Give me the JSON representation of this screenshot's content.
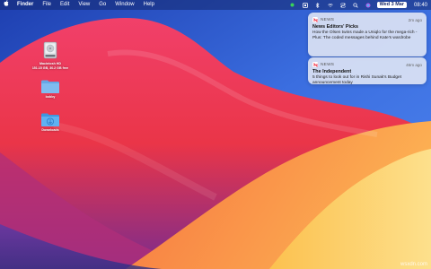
{
  "menubar": {
    "apple_icon": "apple-icon",
    "items": [
      "Finder",
      "File",
      "Edit",
      "View",
      "Go",
      "Window",
      "Help"
    ],
    "status_icons": [
      "battery-dot-icon",
      "audio-icon",
      "bluetooth-icon",
      "wifi-icon",
      "control-center-icon",
      "search-icon",
      "siri-icon"
    ],
    "date": "Wed 3 Mar",
    "time": "08:40"
  },
  "desktop": {
    "icons": [
      {
        "label": "Macintosh HD",
        "sublabel": "151.15 GB, 30.2 GB free",
        "icon": "hard-drive-icon"
      },
      {
        "label": "bobby",
        "sublabel": "",
        "icon": "folder-icon"
      },
      {
        "label": "Downloads",
        "sublabel": "",
        "icon": "downloads-folder-icon"
      }
    ]
  },
  "notifications": [
    {
      "app": "NEWS",
      "time": "2m ago",
      "title": "News Editors' Picks",
      "body": "How the Olsen twins made a Uniqlo for the mega-rich - Plus: The coded messages behind Kate's wardrobe"
    },
    {
      "app": "NEWS",
      "time": "46m ago",
      "title": "The Independent",
      "body": "5 things to look out for in Rishi Sunak's Budget announcement today"
    }
  ],
  "watermark": "wsxdn.com",
  "colors": {
    "wallpaper_top": "#2f5bd0",
    "wallpaper_red": "#ef3a52",
    "wallpaper_orange": "#f99a3c",
    "wallpaper_yellow": "#fbd36a"
  }
}
